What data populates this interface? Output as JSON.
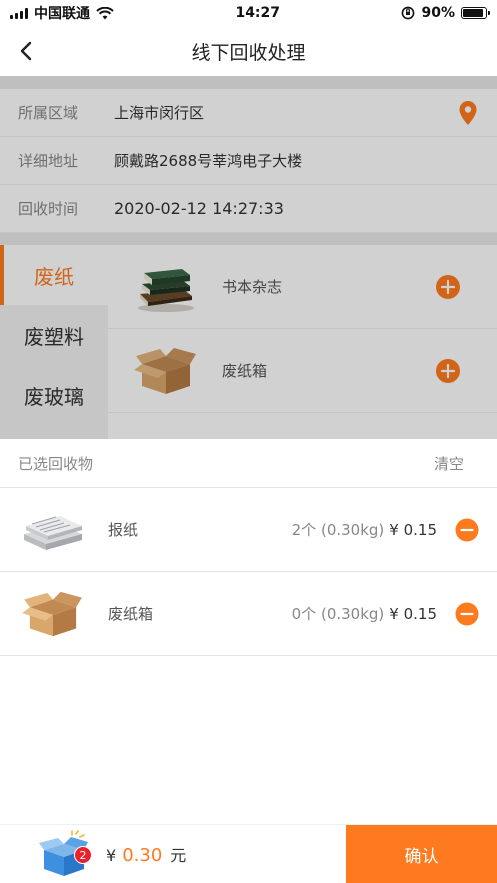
{
  "status_bar": {
    "carrier": "中国联通",
    "time": "14:27",
    "battery": "90%",
    "battery_level": 0.9
  },
  "nav": {
    "title": "线下回收处理",
    "back_icon": "chevron-left-icon"
  },
  "info": {
    "rows": [
      {
        "label": "所属区域",
        "value": "上海市闵行区"
      },
      {
        "label": "详细地址",
        "value": "顾戴路2688号莘鸿电子大楼"
      },
      {
        "label": "回收时间",
        "value": "2020-02-12 14:27:33"
      }
    ],
    "location_icon": "map-pin-icon"
  },
  "categories": [
    {
      "label": "废纸",
      "active": true
    },
    {
      "label": "废塑料",
      "active": false
    },
    {
      "label": "废玻璃",
      "active": false
    }
  ],
  "products": [
    {
      "name": "书本杂志",
      "icon": "books-icon"
    },
    {
      "name": "废纸箱",
      "icon": "cardboard-box-icon"
    }
  ],
  "sheet": {
    "title": "已选回收物",
    "clear_label": "清空",
    "items": [
      {
        "name": "报纸",
        "qty": "2个 (0.30kg)",
        "price": "¥ 0.15",
        "icon": "newspaper-icon"
      },
      {
        "name": "废纸箱",
        "qty": "0个 (0.30kg)",
        "price": "¥ 0.15",
        "icon": "cardboard-box-icon"
      }
    ]
  },
  "footer": {
    "cart_count": "2",
    "currency": "¥",
    "total": "0.30",
    "unit": "元",
    "confirm_label": "确认"
  },
  "colors": {
    "accent": "#ff7a1f",
    "badge": "#e8222b"
  }
}
